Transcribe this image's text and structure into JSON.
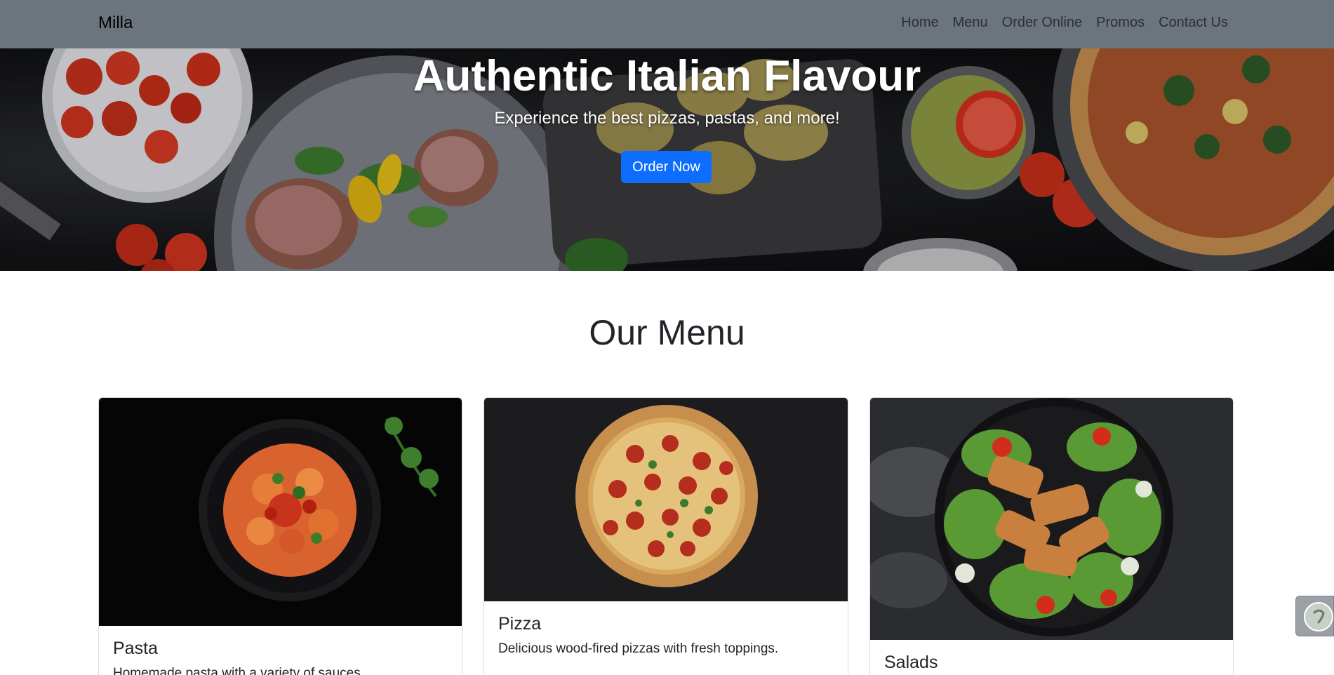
{
  "navbar": {
    "brand": "Milla",
    "links": [
      "Home",
      "Menu",
      "Order Online",
      "Promos",
      "Contact Us"
    ]
  },
  "hero": {
    "title": "Authentic Italian Flavour",
    "subtitle": "Experience the best pizzas, pastas, and more!",
    "button": "Order Now"
  },
  "menu": {
    "title": "Our Menu",
    "items": [
      {
        "title": "Pasta",
        "text": "Homemade pasta with a variety of sauces."
      },
      {
        "title": "Pizza",
        "text": "Delicious wood-fired pizzas with fresh toppings."
      },
      {
        "title": "Salads",
        "text": ""
      }
    ]
  },
  "colors": {
    "navbar": "#6c757d",
    "primary_button": "#0d6efd"
  }
}
